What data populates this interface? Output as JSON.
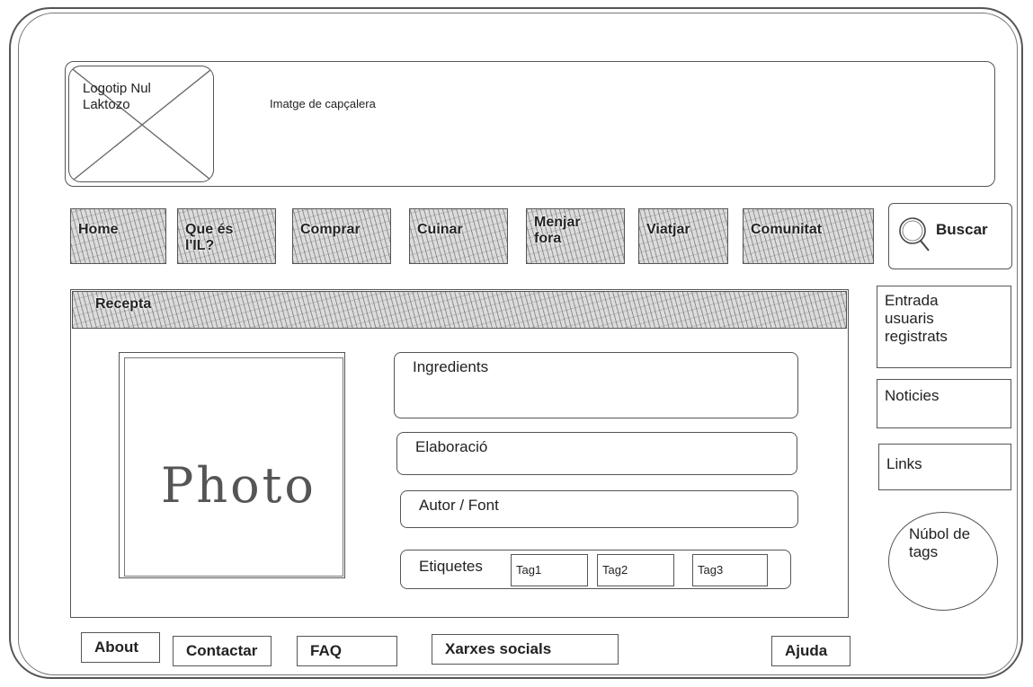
{
  "header": {
    "logo_label": "Logotip Nul\nLaktozo",
    "caption": "Imatge de capçalera"
  },
  "nav": {
    "items": [
      "Home",
      "Que és\nl'IL?",
      "Comprar",
      "Cuinar",
      "Menjar\nfora",
      "Viatjar",
      "Comunitat"
    ],
    "search_label": "Buscar"
  },
  "recipe": {
    "title": "Recepta",
    "photo_label": "Photo",
    "ingredients_label": "Ingredients",
    "elaboration_label": "Elaboració",
    "author_label": "Autor  / Font",
    "tags_label": "Etiquetes",
    "tags": [
      "Tag1",
      "Tag2",
      "Tag3"
    ]
  },
  "sidebar": {
    "login_label": "Entrada\nusuaris\nregistrats",
    "news_label": "Noticies",
    "links_label": "Links",
    "tag_cloud_label": "Núbol de\ntags"
  },
  "footer": {
    "about": "About",
    "contact": "Contactar",
    "faq": "FAQ",
    "social": "Xarxes socials",
    "help": "Ajuda"
  },
  "icons": {
    "search": "magnifier-icon",
    "logo_placeholder": "image-placeholder-icon"
  }
}
